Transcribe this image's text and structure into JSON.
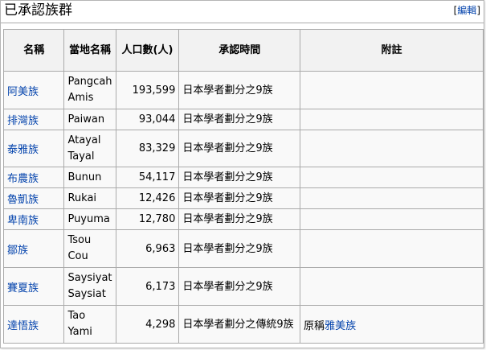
{
  "heading": {
    "title": "已承認族群",
    "edit_open": "[",
    "edit_label": "編輯",
    "edit_close": "]"
  },
  "table": {
    "headers": [
      "名稱",
      "當地名稱",
      "人口數(人)",
      "承認時間",
      "附註"
    ],
    "rows": [
      {
        "name": "阿美族",
        "local": [
          "Pangcah",
          "Amis"
        ],
        "population": "193,599",
        "recognition": "日本學者劃分之9族",
        "note_prefix": "",
        "note_link": ""
      },
      {
        "name": "排灣族",
        "local": [
          "Paiwan"
        ],
        "population": "93,044",
        "recognition": "日本學者劃分之9族",
        "note_prefix": "",
        "note_link": ""
      },
      {
        "name": "泰雅族",
        "local": [
          "Atayal",
          "Tayal"
        ],
        "population": "83,329",
        "recognition": "日本學者劃分之9族",
        "note_prefix": "",
        "note_link": ""
      },
      {
        "name": "布農族",
        "local": [
          "Bunun"
        ],
        "population": "54,117",
        "recognition": "日本學者劃分之9族",
        "note_prefix": "",
        "note_link": ""
      },
      {
        "name": "魯凱族",
        "local": [
          "Rukai"
        ],
        "population": "12,426",
        "recognition": "日本學者劃分之9族",
        "note_prefix": "",
        "note_link": ""
      },
      {
        "name": "卑南族",
        "local": [
          "Puyuma"
        ],
        "population": "12,780",
        "recognition": "日本學者劃分之9族",
        "note_prefix": "",
        "note_link": ""
      },
      {
        "name": "鄒族",
        "local": [
          "Tsou",
          "Cou"
        ],
        "population": "6,963",
        "recognition": "日本學者劃分之9族",
        "note_prefix": "",
        "note_link": ""
      },
      {
        "name": "賽夏族",
        "local": [
          "Saysiyat",
          "Saysiat"
        ],
        "population": "6,173",
        "recognition": "日本學者劃分之9族",
        "note_prefix": "",
        "note_link": ""
      },
      {
        "name": "達悟族",
        "local": [
          "Tao",
          "Yami"
        ],
        "population": "4,298",
        "recognition": "日本學者劃分之傳統9族",
        "note_prefix": "原稱",
        "note_link": "雅美族"
      }
    ]
  },
  "colors": {
    "link": "#0645ad",
    "header_bg": "#f2f2f2",
    "cell_bg": "#f9f9f9",
    "border": "#aaaaaa"
  }
}
